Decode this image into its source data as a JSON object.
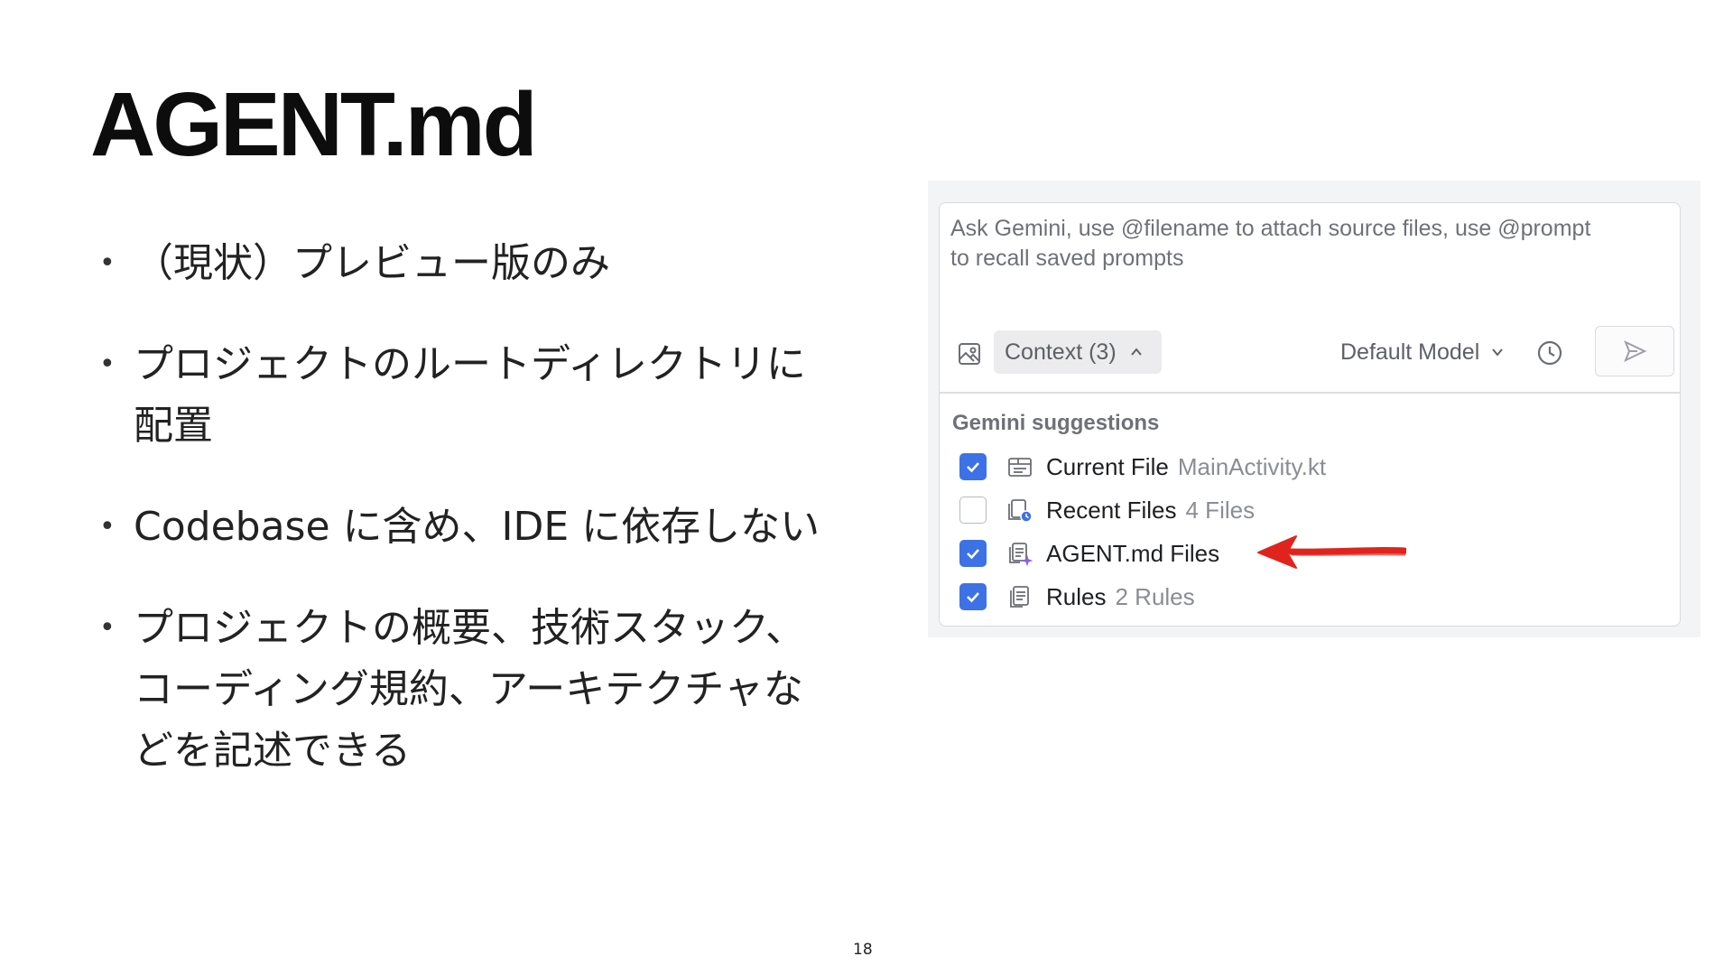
{
  "slide": {
    "title": "AGENT.md",
    "page_number": "18",
    "bullet_symbol": "•",
    "bullets": [
      {
        "lines": [
          "（現状）プレビュー版のみ"
        ]
      },
      {
        "lines": [
          "プロジェクトのルートディレクトリに",
          "配置"
        ]
      },
      {
        "lines": [
          "Codebase に含め、IDE に依存しない"
        ]
      },
      {
        "lines": [
          "プロジェクトの概要、技術スタック、",
          "コーディング規約、アーキテクチャな",
          "どを記述できる"
        ]
      }
    ]
  },
  "chat_panel": {
    "prompt_placeholder": "Ask Gemini, use @filename to attach source files, use @prompt\nto recall saved prompts",
    "toolbar": {
      "image_icon": "image-icon",
      "context_label": "Context (3)",
      "model_label": "Default Model",
      "history_icon": "clock-icon",
      "send_icon": "send-icon"
    },
    "suggestions": {
      "title": "Gemini suggestions",
      "items": [
        {
          "checked": true,
          "icon": "current-file-icon",
          "label": "Current File",
          "detail": "MainActivity.kt"
        },
        {
          "checked": false,
          "icon": "recent-files-icon",
          "label": "Recent Files",
          "detail": "4 Files"
        },
        {
          "checked": true,
          "icon": "agent-file-icon",
          "label": "AGENT.md Files",
          "detail": ""
        },
        {
          "checked": true,
          "icon": "rules-icon",
          "label": "Rules",
          "detail": "2 Rules"
        }
      ]
    },
    "colors": {
      "checkbox_checked": "#3c72e6",
      "annotation_arrow": "#e0241d",
      "muted_text": "#6e7177"
    }
  }
}
